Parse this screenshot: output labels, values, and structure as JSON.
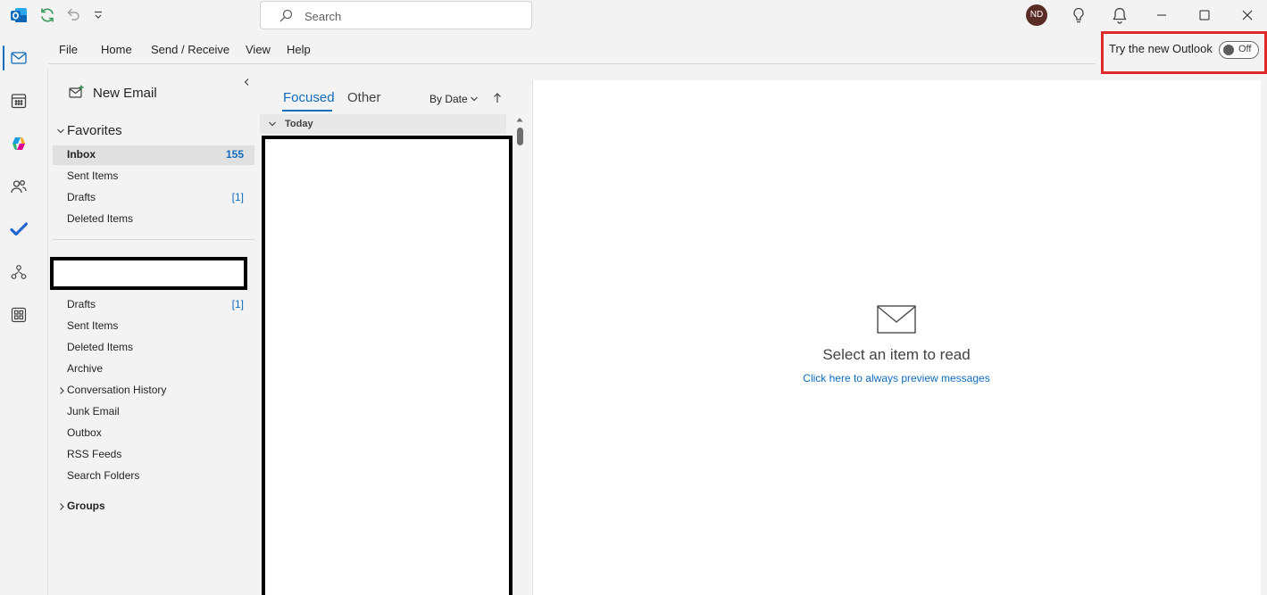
{
  "titlebar": {
    "search_placeholder": "Search",
    "user_initials": "ND",
    "icons": [
      "outlook-logo-icon",
      "sync-icon",
      "undo-icon",
      "customize-toolbar-icon",
      "search-icon",
      "lightbulb-icon",
      "bell-icon",
      "minimize-icon",
      "maximize-icon",
      "close-icon"
    ]
  },
  "ribbon": {
    "menu": [
      "File",
      "Home",
      "Send / Receive",
      "View",
      "Help"
    ],
    "try_new_outlook_label": "Try the new Outlook",
    "toggle_state": "Off"
  },
  "rail": {
    "items": [
      "mail-icon",
      "calendar-icon",
      "copilot-icon",
      "people-icon",
      "todo-icon",
      "org-explorer-icon",
      "apps-icon"
    ],
    "active": "mail-icon"
  },
  "folder_pane": {
    "new_email_label": "New Email",
    "favorites_label": "Favorites",
    "favorites": [
      {
        "label": "Inbox",
        "count": "155"
      },
      {
        "label": "Sent Items",
        "count": ""
      },
      {
        "label": "Drafts",
        "count": "[1]"
      },
      {
        "label": "Deleted Items",
        "count": ""
      }
    ],
    "account_folders": [
      {
        "label": "Drafts",
        "count": "[1]"
      },
      {
        "label": "Sent Items",
        "count": ""
      },
      {
        "label": "Deleted Items",
        "count": ""
      },
      {
        "label": "Archive",
        "count": ""
      },
      {
        "label": "Conversation History",
        "count": ""
      },
      {
        "label": "Junk Email",
        "count": ""
      },
      {
        "label": "Outbox",
        "count": ""
      },
      {
        "label": "RSS Feeds",
        "count": ""
      },
      {
        "label": "Search Folders",
        "count": ""
      }
    ],
    "groups_label": "Groups"
  },
  "message_list": {
    "tabs": [
      "Focused",
      "Other"
    ],
    "active_tab": "Focused",
    "sort_label": "By Date",
    "group_header": "Today"
  },
  "reading_pane": {
    "empty_title": "Select an item to read",
    "preview_link": "Click here to always preview messages"
  },
  "colors": {
    "accent": "#0f6cbd",
    "highlight_box": "#e02a2a",
    "avatar_bg": "#5a2d24"
  }
}
